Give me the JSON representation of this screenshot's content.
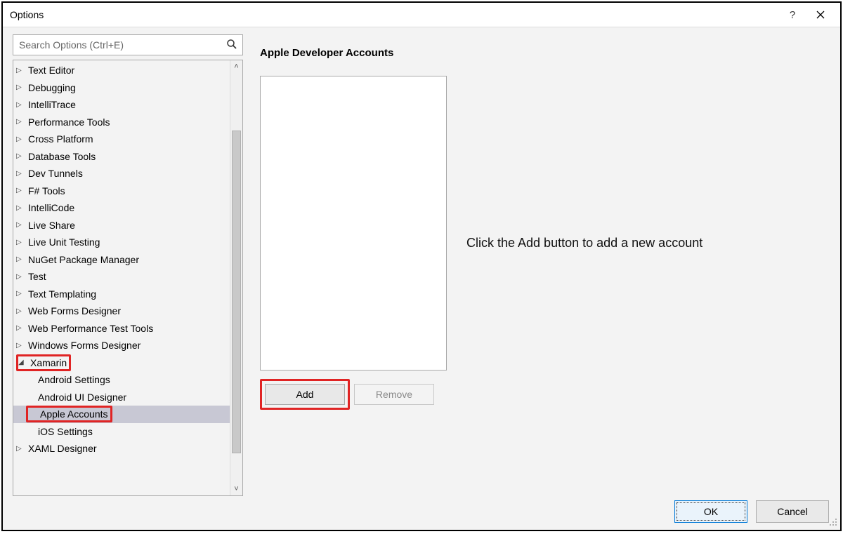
{
  "window": {
    "title": "Options"
  },
  "search": {
    "placeholder": "Search Options (Ctrl+E)"
  },
  "tree": {
    "items": [
      {
        "label": "Text Editor",
        "depth": 0,
        "expander": "▷"
      },
      {
        "label": "Debugging",
        "depth": 0,
        "expander": "▷"
      },
      {
        "label": "IntelliTrace",
        "depth": 0,
        "expander": "▷"
      },
      {
        "label": "Performance Tools",
        "depth": 0,
        "expander": "▷"
      },
      {
        "label": "Cross Platform",
        "depth": 0,
        "expander": "▷"
      },
      {
        "label": "Database Tools",
        "depth": 0,
        "expander": "▷"
      },
      {
        "label": "Dev Tunnels",
        "depth": 0,
        "expander": "▷"
      },
      {
        "label": "F# Tools",
        "depth": 0,
        "expander": "▷"
      },
      {
        "label": "IntelliCode",
        "depth": 0,
        "expander": "▷"
      },
      {
        "label": "Live Share",
        "depth": 0,
        "expander": "▷"
      },
      {
        "label": "Live Unit Testing",
        "depth": 0,
        "expander": "▷"
      },
      {
        "label": "NuGet Package Manager",
        "depth": 0,
        "expander": "▷"
      },
      {
        "label": "Test",
        "depth": 0,
        "expander": "▷"
      },
      {
        "label": "Text Templating",
        "depth": 0,
        "expander": "▷"
      },
      {
        "label": "Web Forms Designer",
        "depth": 0,
        "expander": "▷"
      },
      {
        "label": "Web Performance Test Tools",
        "depth": 0,
        "expander": "▷"
      },
      {
        "label": "Windows Forms Designer",
        "depth": 0,
        "expander": "▷"
      },
      {
        "label": "Xamarin",
        "depth": 0,
        "expander": "◢",
        "highlight": true
      },
      {
        "label": "Android Settings",
        "depth": 1
      },
      {
        "label": "Android UI Designer",
        "depth": 1
      },
      {
        "label": "Apple Accounts",
        "depth": 1,
        "selected": true,
        "highlight": true
      },
      {
        "label": "iOS Settings",
        "depth": 1
      },
      {
        "label": "XAML Designer",
        "depth": 0,
        "expander": "▷"
      }
    ]
  },
  "panel": {
    "title": "Apple Developer Accounts",
    "hint": "Click the Add button to add a new account",
    "add_label": "Add",
    "remove_label": "Remove"
  },
  "buttons": {
    "ok": "OK",
    "cancel": "Cancel"
  }
}
